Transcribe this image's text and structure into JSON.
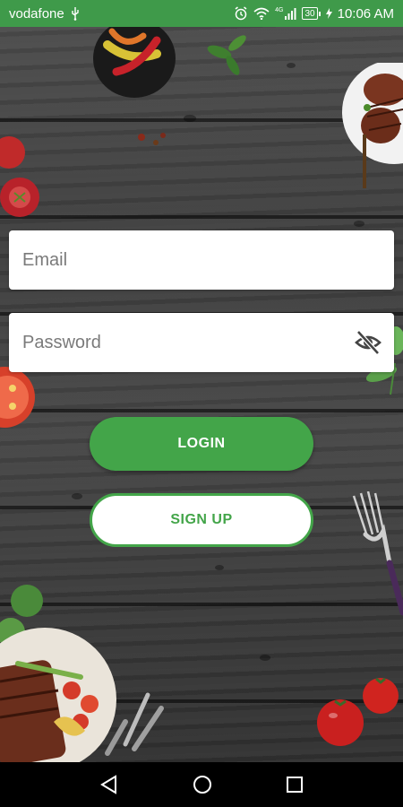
{
  "status_bar": {
    "carrier": "vodafone",
    "network": "4G",
    "battery": "30",
    "time": "10:06 AM",
    "background_color": "#3f9a4a"
  },
  "form": {
    "email_placeholder": "Email",
    "password_placeholder": "Password",
    "toggle_icon": "eye-off-icon"
  },
  "buttons": {
    "login_label": "LOGIN",
    "signup_label": "SIGN UP",
    "accent_color": "#43a549"
  },
  "nav_bar": {
    "back_icon": "back-triangle-icon",
    "home_icon": "home-circle-icon",
    "recents_icon": "recents-square-icon"
  }
}
